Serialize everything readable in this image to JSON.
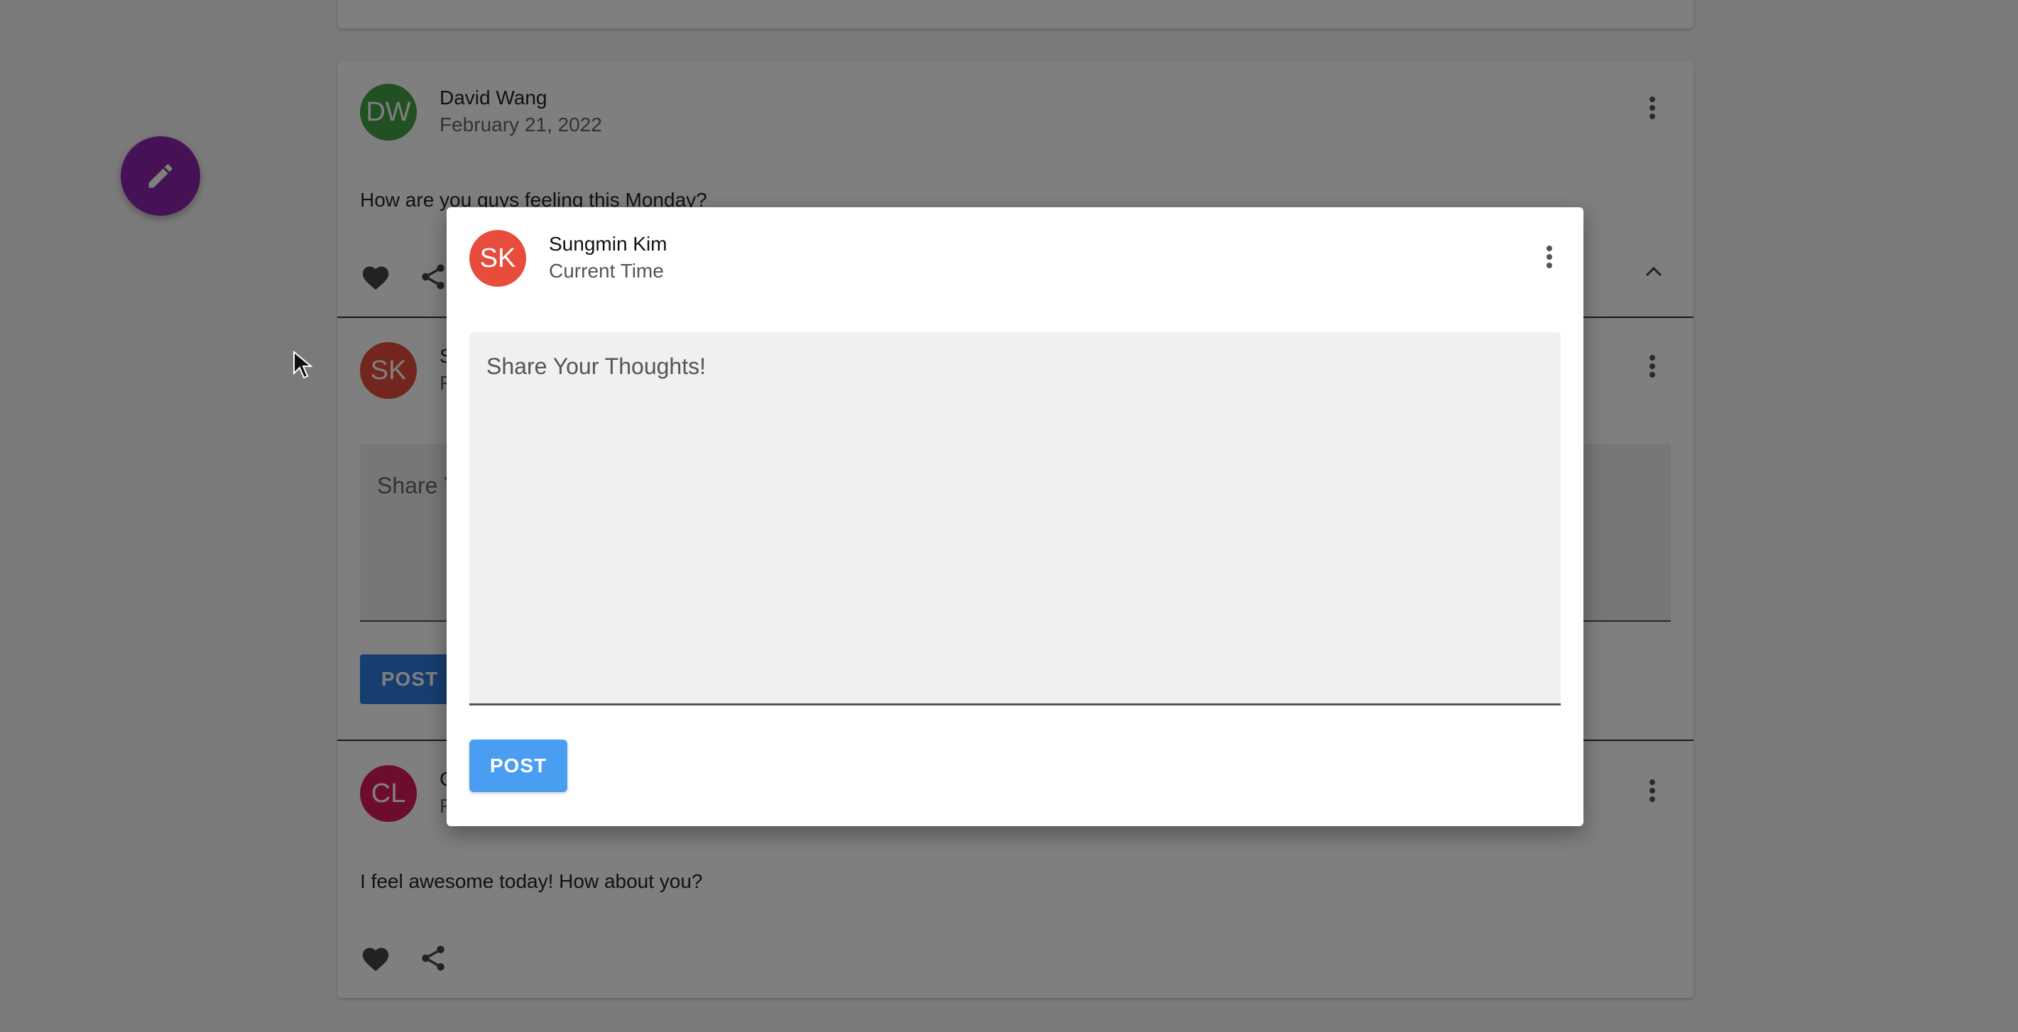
{
  "feed": {
    "post1": {
      "initials": "DW",
      "avatar_color": "#43a047",
      "name": "David Wang",
      "date": "February 21, 2022",
      "text": "How are you guys feeling this Monday?"
    },
    "comment_box": {
      "initials": "SK",
      "avatar_color": "#e74c3c",
      "name_partial": "S",
      "date_partial": "F",
      "placeholder_partial": "Share Y",
      "post_label": "POST"
    },
    "post2": {
      "initials": "CL",
      "avatar_color": "#d81b60",
      "name_partial": "C",
      "date_partial": "F",
      "text": "I feel awesome today! How about you?"
    }
  },
  "fab": {
    "icon": "pencil-icon",
    "color": "#8e24aa"
  },
  "modal": {
    "initials": "SK",
    "avatar_color": "#e74c3c",
    "name": "Sungmin Kim",
    "time": "Current Time",
    "placeholder": "Share Your Thoughts!",
    "post_label": "POST",
    "post_color": "#4a9ef2"
  }
}
